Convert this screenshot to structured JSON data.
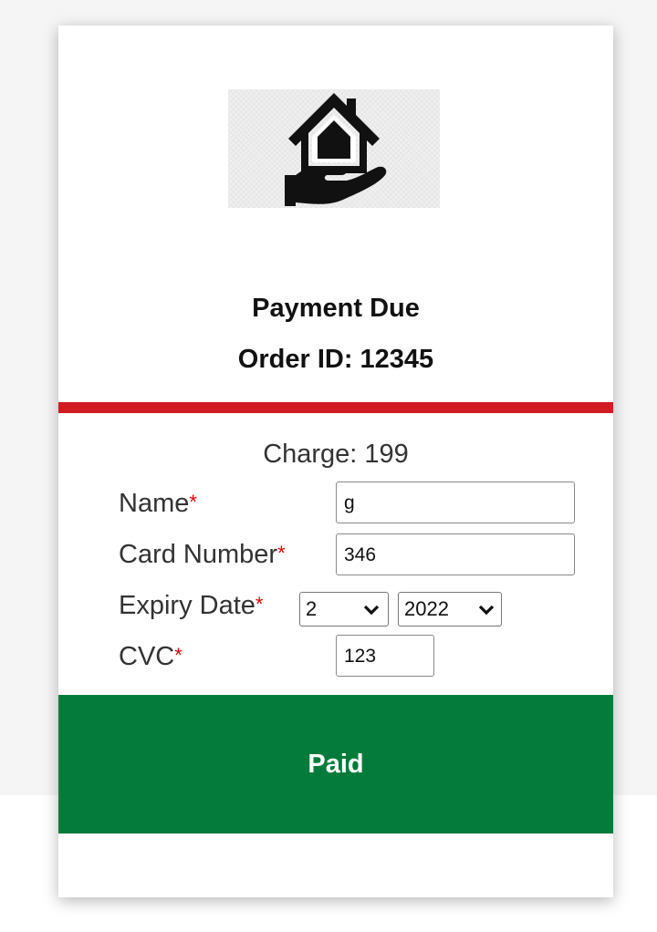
{
  "header": {
    "logo_icon": "house-in-hand-icon",
    "title": "Payment Due",
    "order_label": "Order ID: 12345"
  },
  "accent_colors": {
    "divider": "#d11a22",
    "button": "#047b3a",
    "required_marker": "#e00000"
  },
  "charge": {
    "text": "Charge: 199"
  },
  "form": {
    "name": {
      "label": "Name",
      "required": "*",
      "value": "g"
    },
    "card_number": {
      "label": "Card Number",
      "required": "*",
      "value": "346"
    },
    "expiry": {
      "label": "Expiry Date",
      "required": "*",
      "month": "2",
      "year": "2022"
    },
    "cvc": {
      "label": "CVC",
      "required": "*",
      "value": "123"
    }
  },
  "submit": {
    "label": "Paid"
  }
}
